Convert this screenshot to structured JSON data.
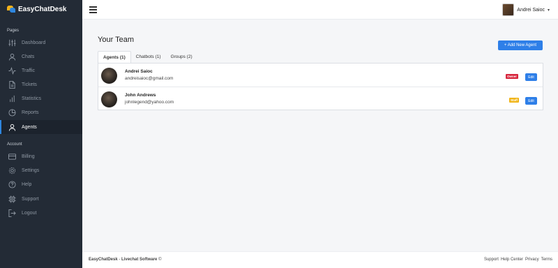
{
  "brand": {
    "name": "EasyChatDesk"
  },
  "sidebar": {
    "pages_label": "Pages",
    "account_label": "Account",
    "pages": [
      {
        "label": "Dashboard",
        "icon": "sliders-icon"
      },
      {
        "label": "Chats",
        "icon": "user-icon"
      },
      {
        "label": "Traffic",
        "icon": "activity-icon"
      },
      {
        "label": "Tickets",
        "icon": "file-icon"
      },
      {
        "label": "Statistics",
        "icon": "bar-chart-icon"
      },
      {
        "label": "Reports",
        "icon": "pie-chart-icon"
      },
      {
        "label": "Agents",
        "icon": "user-icon",
        "active": true
      }
    ],
    "account": [
      {
        "label": "Billing",
        "icon": "credit-card-icon"
      },
      {
        "label": "Settings",
        "icon": "gear-icon"
      },
      {
        "label": "Help",
        "icon": "help-circle-icon"
      },
      {
        "label": "Support",
        "icon": "cpu-icon"
      },
      {
        "label": "Logout",
        "icon": "logout-icon"
      }
    ]
  },
  "topbar": {
    "user_name": "Andrei Saioc",
    "caret": "▾"
  },
  "main": {
    "title": "Your Team",
    "add_button": "+ Add New Agent",
    "tabs": [
      {
        "label": "Agents (1)",
        "active": true
      },
      {
        "label": "Chatbots (1)"
      },
      {
        "label": "Groups (2)"
      }
    ],
    "agents": [
      {
        "name": "Andrei Saioc",
        "email": "andreisaioc@gmail.com",
        "role": "Owner",
        "edit": "Edit"
      },
      {
        "name": "John Andrews",
        "email": "johnlegend@yahoo.com",
        "role": "Staff",
        "edit": "Edit"
      }
    ]
  },
  "footer": {
    "brand": "EasyChatDesk",
    "separator": " - ",
    "product": "Livechat Software",
    "copyright": "©",
    "links": [
      "Support",
      "Help Center",
      "Privacy",
      "Terms"
    ]
  },
  "colors": {
    "sidebar_bg": "#232b36",
    "accent": "#2e7fe8",
    "owner_badge": "#d7263d",
    "staff_badge": "#f0b417"
  }
}
